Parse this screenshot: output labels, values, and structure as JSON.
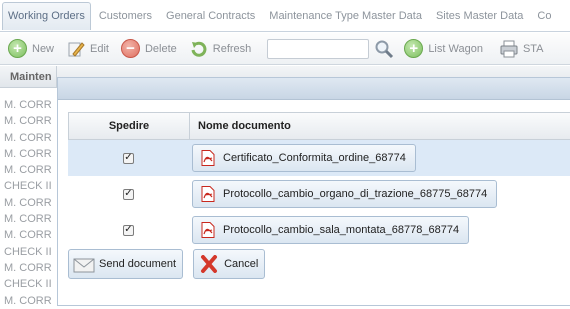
{
  "tabs": [
    {
      "label": "Working Orders",
      "active": true
    },
    {
      "label": "Customers"
    },
    {
      "label": "General Contracts"
    },
    {
      "label": "Maintenance Type Master Data"
    },
    {
      "label": "Sites Master Data"
    },
    {
      "label": "Co"
    }
  ],
  "toolbar": {
    "new_label": "New",
    "edit_label": "Edit",
    "delete_label": "Delete",
    "refresh_label": "Refresh",
    "search_value": "",
    "list_wagon_label": "List Wagon",
    "sta_label": "STA"
  },
  "grid": {
    "header": "Mainten",
    "rows": [
      "M. CORR",
      "M. CORR",
      "M. CORR",
      "M. CORR",
      "M. CORR",
      "CHECK II",
      "M. CORR",
      "M. CORR",
      "M. CORR",
      "CHECK II",
      "M. CORR",
      "CHECK II",
      "M. CORR"
    ]
  },
  "dialog": {
    "columns": {
      "spedire": "Spedire",
      "nome_documento": "Nome documento"
    },
    "documents": [
      {
        "checked": true,
        "name": "Certificato_Conformita_ordine_68774",
        "selected": true
      },
      {
        "checked": true,
        "name": "Protocollo_cambio_organo_di_trazione_68775_68774",
        "selected": false
      },
      {
        "checked": true,
        "name": "Protocollo_cambio_sala_montata_68778_68774",
        "selected": false
      }
    ],
    "send_label": "Send document",
    "cancel_label": "Cancel"
  },
  "colors": {
    "accent": "#dce9f7",
    "pdf": "#c8281e"
  }
}
